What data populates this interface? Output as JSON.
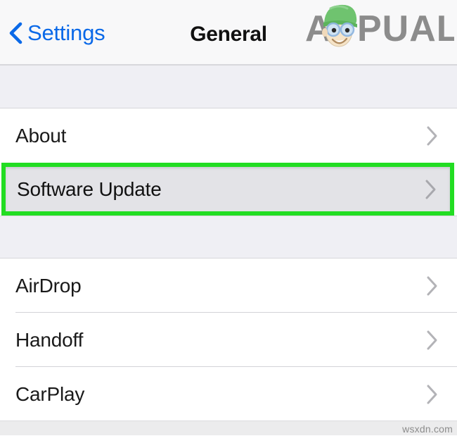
{
  "navbar": {
    "back_label": "Settings",
    "back_icon": "chevron-left-icon",
    "title": "General",
    "accent_color": "#0a69e8",
    "background_color": "#f8f8f9"
  },
  "brand": {
    "name_part_one": "A",
    "name_part_two": "PUALS",
    "full_name": "APPUALS",
    "text_color": "#8c8c8c",
    "hat_color": "#6fc36f",
    "skin_color": "#f6e4c8",
    "glasses_color": "#8fb6e0"
  },
  "sections": [
    {
      "name": "section-one",
      "rows": [
        {
          "label": "About",
          "accessory": "chevron-right-icon",
          "highlighted": false
        }
      ]
    },
    {
      "name": "section-highlighted",
      "rows": [
        {
          "label": "Software Update",
          "accessory": "chevron-right-icon",
          "highlighted": true
        }
      ]
    },
    {
      "name": "section-two",
      "rows": [
        {
          "label": "AirDrop",
          "accessory": "chevron-right-icon",
          "highlighted": false
        },
        {
          "label": "Handoff",
          "accessory": "chevron-right-icon",
          "highlighted": false
        },
        {
          "label": "CarPlay",
          "accessory": "chevron-right-icon",
          "highlighted": false
        }
      ]
    }
  ],
  "annotation": {
    "type": "rectangle-highlight",
    "target_label": "Software Update",
    "border_color": "#22dd22",
    "border_width_px": 6,
    "fill_color": "#e3e3e7"
  },
  "colors": {
    "row_background": "#ffffff",
    "group_gap_background": "#efeff4",
    "separator": "#d3d3d7",
    "chevron": "#b3b3b7",
    "row_text": "#1a1a1a",
    "footer_background": "#ececed"
  },
  "footer": {
    "watermark": "wsxdn.com"
  }
}
